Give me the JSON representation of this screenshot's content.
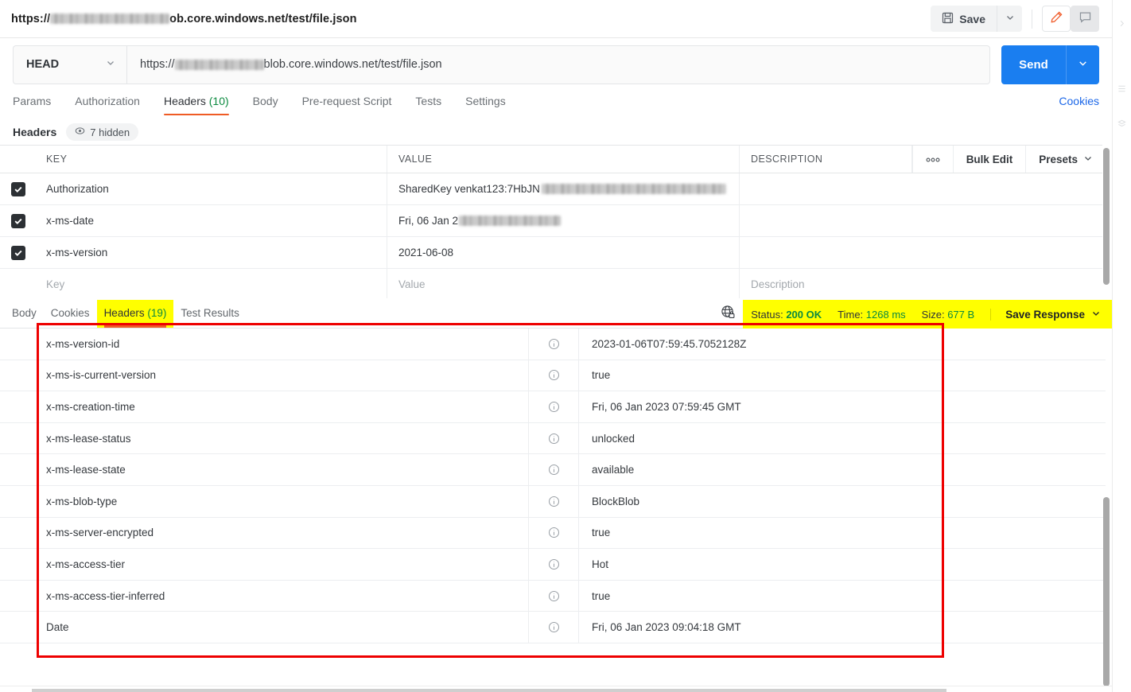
{
  "titlebar": {
    "url_prefix": "https://",
    "url_suffix": "ob.core.windows.net/test/file.json",
    "save_label": "Save",
    "icons": {
      "floppy": "floppy-disk-icon",
      "caret": "chevron-down-icon",
      "pencil": "pencil-icon",
      "comment": "comment-icon"
    }
  },
  "request": {
    "method": "HEAD",
    "url_prefix": "https://",
    "url_suffix": "blob.core.windows.net/test/file.json",
    "send_label": "Send",
    "tabs": [
      {
        "label": "Params",
        "count": "",
        "active": false
      },
      {
        "label": "Authorization",
        "count": "",
        "active": false
      },
      {
        "label": "Headers",
        "count": "(10)",
        "active": true
      },
      {
        "label": "Body",
        "count": "",
        "active": false
      },
      {
        "label": "Pre-request Script",
        "count": "",
        "active": false
      },
      {
        "label": "Tests",
        "count": "",
        "active": false
      },
      {
        "label": "Settings",
        "count": "",
        "active": false
      }
    ],
    "cookies_link": "Cookies",
    "headers_title": "Headers",
    "hidden_badge": "7 hidden",
    "table": {
      "columns": [
        "KEY",
        "VALUE",
        "DESCRIPTION"
      ],
      "actions": {
        "more": "•••",
        "bulk_edit": "Bulk Edit",
        "presets": "Presets"
      },
      "rows": [
        {
          "checked": true,
          "key": "Authorization",
          "value": "SharedKey venkat123:7HbJN",
          "value_redacted": true,
          "description": ""
        },
        {
          "checked": true,
          "key": "x-ms-date",
          "value": " Fri, 06 Jan 2",
          "value_redacted": true,
          "description": ""
        },
        {
          "checked": true,
          "key": "x-ms-version",
          "value": "2021-06-08",
          "value_redacted": false,
          "description": ""
        }
      ],
      "placeholder_row": {
        "key": "Key",
        "value": "Value",
        "description": "Description"
      }
    }
  },
  "response": {
    "tabs": [
      {
        "label": "Body",
        "count": "",
        "active": false,
        "highlighted": false
      },
      {
        "label": "Cookies",
        "count": "",
        "active": false,
        "highlighted": false
      },
      {
        "label": "Headers",
        "count": "(19)",
        "active": true,
        "highlighted": true
      },
      {
        "label": "Test Results",
        "count": "",
        "active": false,
        "highlighted": false
      }
    ],
    "status": {
      "status_label": "Status:",
      "status_value": "200 OK",
      "time_label": "Time:",
      "time_value": "1268 ms",
      "size_label": "Size:",
      "size_value": "677 B",
      "save_response": "Save Response"
    },
    "headers": [
      {
        "key": "x-ms-version-id",
        "value": "2023-01-06T07:59:45.7052128Z"
      },
      {
        "key": "x-ms-is-current-version",
        "value": "true"
      },
      {
        "key": "x-ms-creation-time",
        "value": "Fri, 06 Jan 2023 07:59:45 GMT"
      },
      {
        "key": "x-ms-lease-status",
        "value": "unlocked"
      },
      {
        "key": "x-ms-lease-state",
        "value": "available"
      },
      {
        "key": "x-ms-blob-type",
        "value": "BlockBlob"
      },
      {
        "key": "x-ms-server-encrypted",
        "value": "true"
      },
      {
        "key": "x-ms-access-tier",
        "value": "Hot"
      },
      {
        "key": "x-ms-access-tier-inferred",
        "value": "true"
      },
      {
        "key": "Date",
        "value": "Fri, 06 Jan 2023 09:04:18 GMT"
      }
    ]
  },
  "colors": {
    "accent_orange": "#ef5b25",
    "send_blue": "#1a7ef0",
    "link_blue": "#1a66e8",
    "status_green": "#0b8a3f",
    "annotation_red": "#ee0000",
    "highlight_yellow": "#ffff00"
  }
}
